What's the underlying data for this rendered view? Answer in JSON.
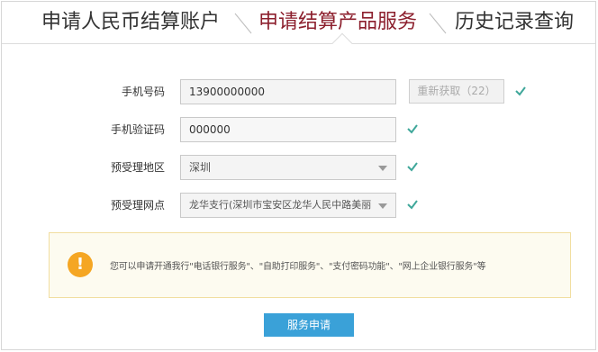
{
  "tabs": [
    {
      "label": "申请人民币结算账户",
      "active": false
    },
    {
      "label": "申请结算产品服务",
      "active": true
    },
    {
      "label": "历史记录查询",
      "active": false
    }
  ],
  "form": {
    "phone": {
      "label": "手机号码",
      "value": "13900000000",
      "resend_label": "重新获取（22）"
    },
    "code": {
      "label": "手机验证码",
      "value": "000000"
    },
    "region": {
      "label": "预受理地区",
      "value": "深圳"
    },
    "branch": {
      "label": "预受理网点",
      "value": "龙华支行(深圳市宝安区龙华人民中路美丽"
    }
  },
  "notice": {
    "icon": "warning-icon",
    "text": "您可以申请开通我行\"电话银行服务\"、\"自助打印服务\"、\"支付密码功能\"、\"网上企业银行服务\"等"
  },
  "submit_label": "服务申请",
  "colors": {
    "active_tab": "#8c1f2d",
    "check": "#3fa79a",
    "button": "#3aa1d8",
    "warning": "#f5a623"
  }
}
